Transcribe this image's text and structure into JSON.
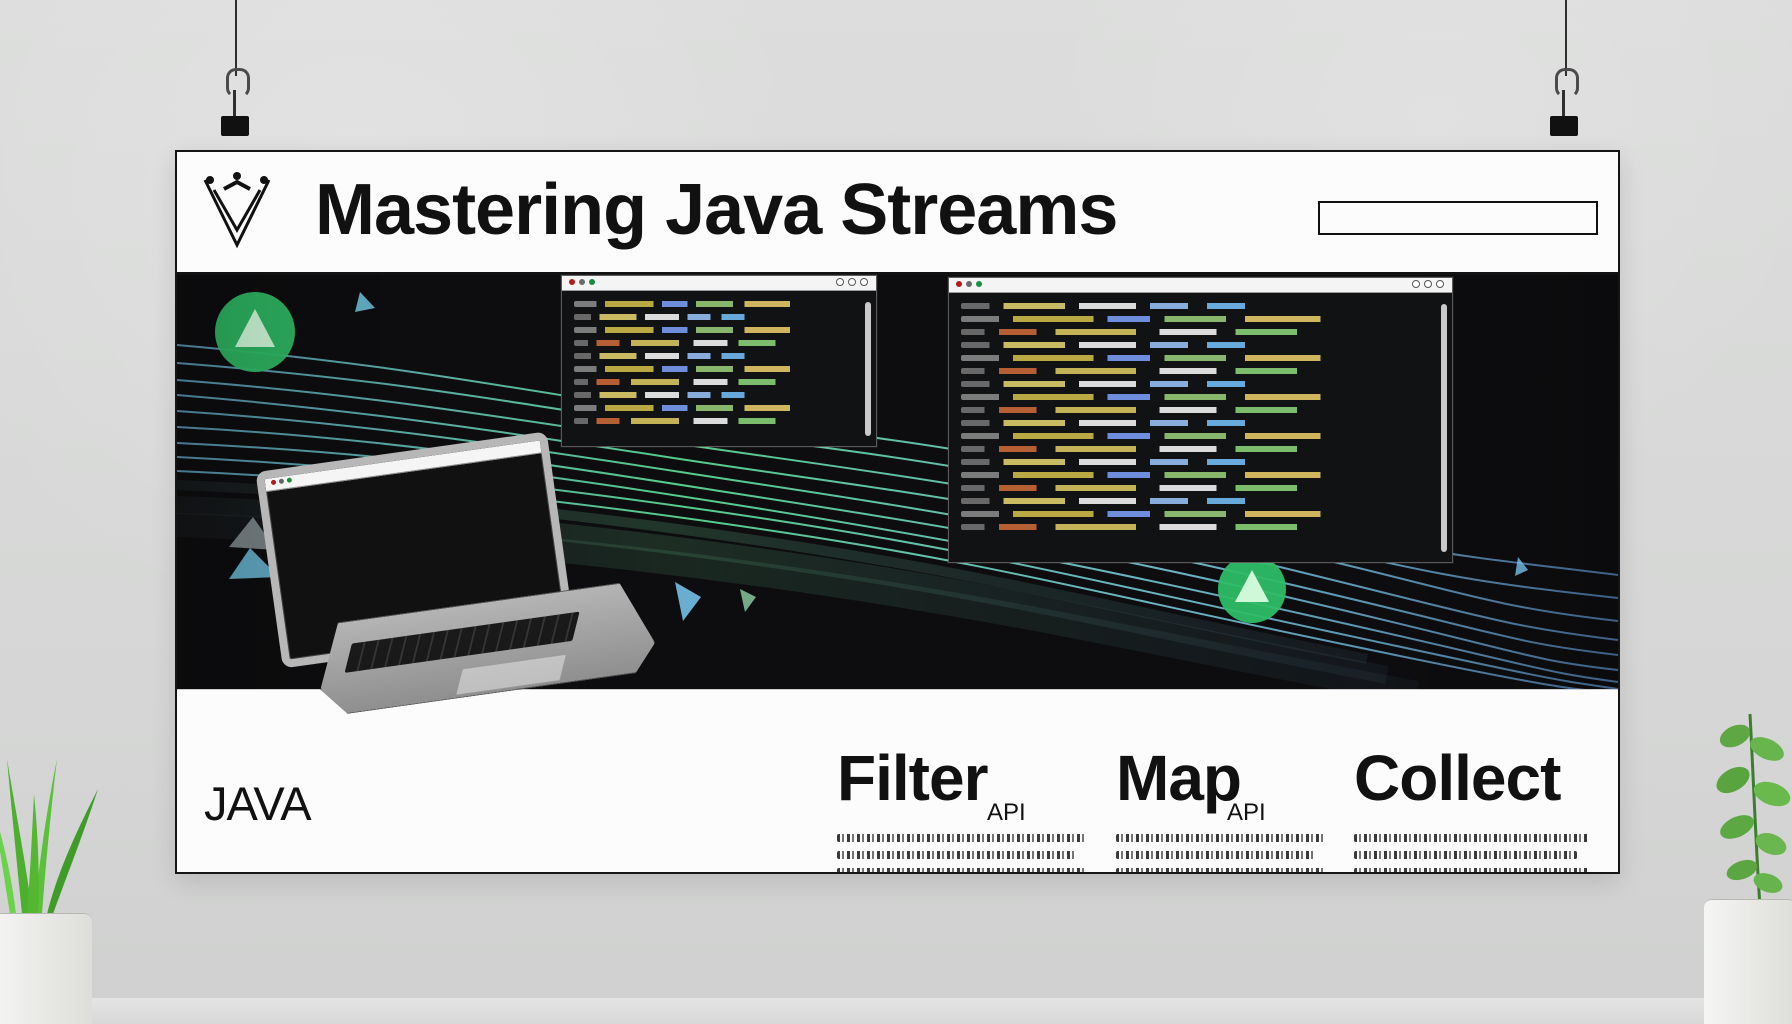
{
  "poster": {
    "title": "Mastering Java Streams",
    "java_label": "JAVA",
    "logo_icon": "stream-logo-icon",
    "features": [
      {
        "title": "Filter",
        "subtitle": "API"
      },
      {
        "title": "Map",
        "subtitle": "API"
      },
      {
        "title": "Collect"
      }
    ]
  },
  "colors": {
    "accent_green": "#2fbf67",
    "accent_teal": "#76cfe0",
    "accent_blue": "#8fd5ff"
  },
  "icons": {
    "binder_clip": "binder-clip-icon",
    "triangle": "triangle-icon",
    "plant": "plant-icon"
  }
}
